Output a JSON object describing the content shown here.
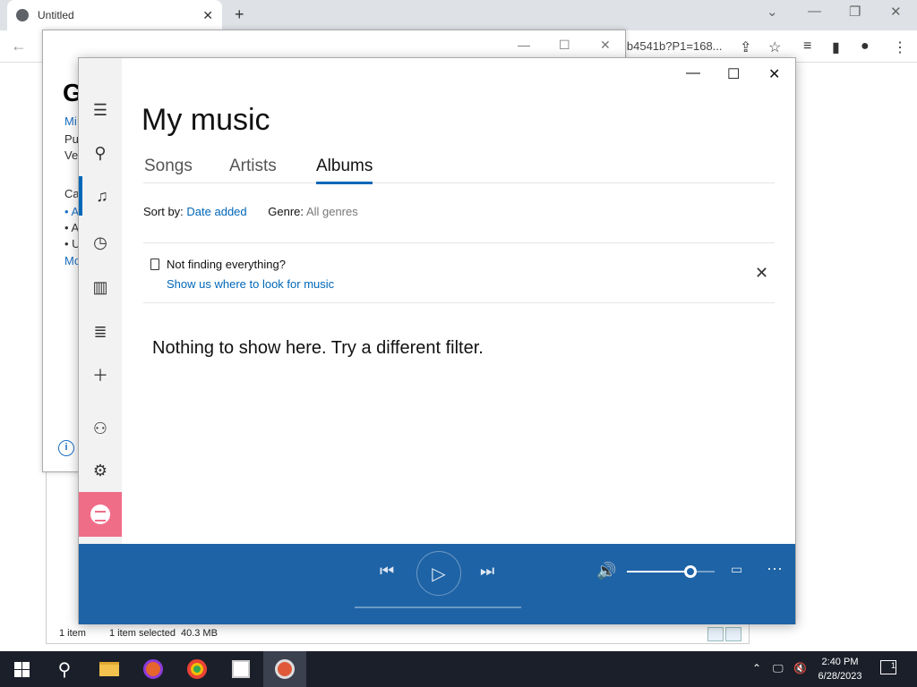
{
  "browser": {
    "tab_title": "Untitled",
    "new_tab_glyph": "+",
    "url_fragment": "lb4541b?P1=168..."
  },
  "explorer": {
    "status_items": "1 item",
    "status_selected": "1 item selected",
    "status_size": "40.3 MB"
  },
  "bg_window": {
    "heading": "G",
    "lines": [
      "Mi",
      "Pu",
      "Ve"
    ],
    "section": "Ca",
    "bullets": [
      "A",
      "A",
      "U"
    ],
    "more": "Mo"
  },
  "music": {
    "title": "My music",
    "tabs": [
      "Songs",
      "Artists",
      "Albums"
    ],
    "active_tab": "Albums",
    "sort_label": "Sort by:",
    "sort_value": "Date added",
    "genre_label": "Genre:",
    "genre_value": "All genres",
    "notice_title": "Not finding everything?",
    "notice_link": "Show us where to look for music",
    "empty_message": "Nothing to show here. Try a different filter.",
    "rail_icons": [
      "hamburger-icon",
      "search-icon",
      "music-note-icon",
      "recent-icon",
      "charts-icon",
      "now-playing-icon",
      "add-icon",
      "add-account-icon",
      "settings-icon",
      "spotify-icon"
    ],
    "volume": 0.72
  },
  "taskbar": {
    "time": "2:40 PM",
    "date": "6/28/2023",
    "notification_count": "1",
    "apps": [
      "start",
      "search",
      "file-explorer",
      "firefox",
      "chrome",
      "package",
      "groove-music"
    ]
  },
  "colors": {
    "accent": "#0067b8",
    "player_bg": "#1e63a6",
    "spotify_bg": "#f06d88",
    "taskbar_bg": "#1b1f2a"
  }
}
